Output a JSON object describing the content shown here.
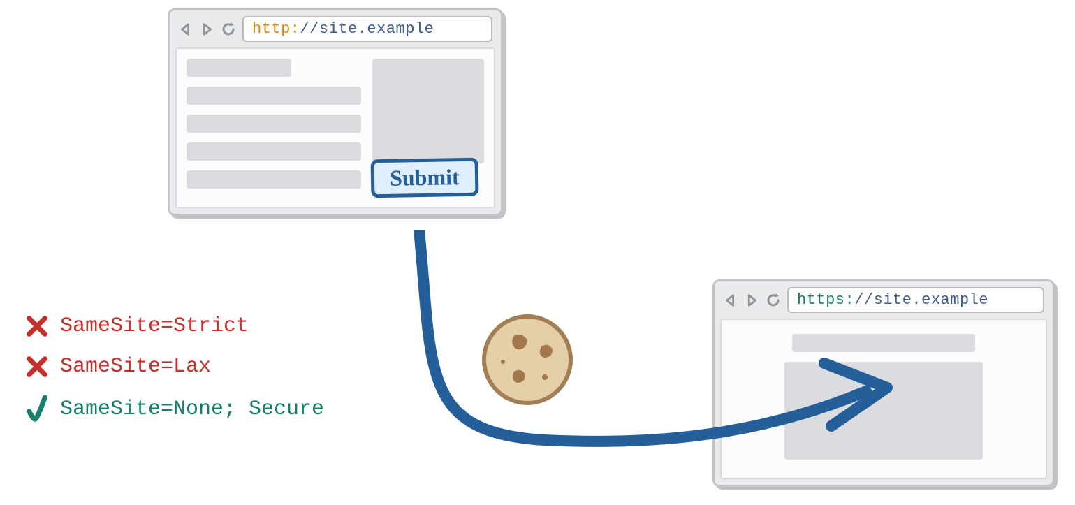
{
  "browsers": {
    "source": {
      "protocol": "http:",
      "url_rest": "//site.example",
      "submit_label": "Submit"
    },
    "target": {
      "protocol": "https:",
      "url_rest": "//site.example"
    }
  },
  "rules": [
    {
      "allowed": false,
      "label": "SameSite=Strict"
    },
    {
      "allowed": false,
      "label": "SameSite=Lax"
    },
    {
      "allowed": true,
      "label": "SameSite=None; Secure"
    }
  ],
  "colors": {
    "arrow": "#255f9a",
    "red": "#c6302c",
    "green": "#17806d"
  }
}
